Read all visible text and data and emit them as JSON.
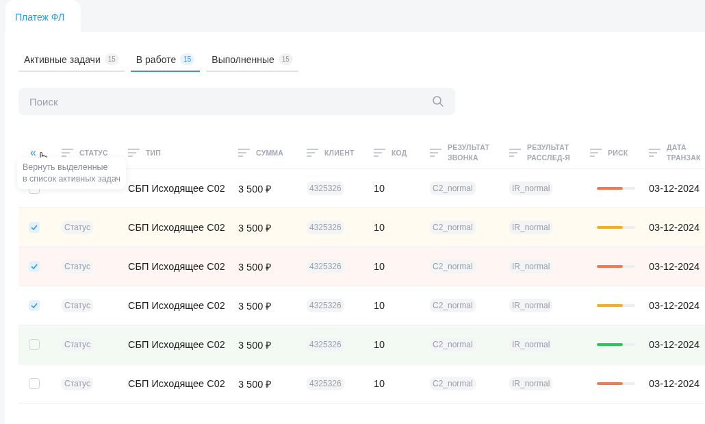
{
  "page_tab": {
    "label": "Платеж ФЛ",
    "selected": true
  },
  "tabs": [
    {
      "label": "Активные задачи",
      "count": "15",
      "selected": false
    },
    {
      "label": "В работе",
      "count": "15",
      "selected": true
    },
    {
      "label": "Выполненные",
      "count": "15",
      "selected": false
    }
  ],
  "search": {
    "placeholder": "Поиск"
  },
  "table": {
    "back_button": "«",
    "tooltip": "Вернуть выделенные\nв список активных задач",
    "columns": [
      {
        "label": "СТАТУС"
      },
      {
        "label": "ТИП"
      },
      {
        "label": "СУММА"
      },
      {
        "label": "КЛИЕНТ"
      },
      {
        "label": "КОД"
      },
      {
        "label": "РЕЗУЛЬТАТ\nЗВОНКА"
      },
      {
        "label": "РЕЗУЛЬТАТ\nРАССЛЕД-Я"
      },
      {
        "label": "РИСК"
      },
      {
        "label": "ДАТА\nТРАНЗАК"
      }
    ],
    "rows": [
      {
        "checked": false,
        "type": "СБП Исходящее С02",
        "amount": "3 500 ₽",
        "client": "4325326",
        "code": "10",
        "call_result": "C2_normal",
        "investigation": "IR_normal",
        "risk": {
          "level": 0.68,
          "color": "#f07a55"
        },
        "date": "03-12-2024"
      },
      {
        "checked": true,
        "color": "#fffbf1",
        "status": "Статус",
        "type": "СБП Исходящее С02",
        "amount": "3 500 ₽",
        "client": "4325326",
        "code": "10",
        "call_result": "C2_normal",
        "investigation": "IR_normal",
        "risk": {
          "level": 0.68,
          "color": "#f2b01e"
        },
        "date": "03-12-2024"
      },
      {
        "checked": true,
        "color": "#fff5f3",
        "status": "Статус",
        "type": "СБП Исходящее С02",
        "amount": "3 500 ₽",
        "client": "4325326",
        "code": "10",
        "call_result": "C2_normal",
        "investigation": "IR_normal",
        "risk": {
          "level": 0.68,
          "color": "#f07a55"
        },
        "date": "03-12-2024"
      },
      {
        "checked": true,
        "status": "Статус",
        "type": "СБП Исходящее С02",
        "amount": "3 500 ₽",
        "client": "4325326",
        "code": "10",
        "call_result": "C2_normal",
        "investigation": "IR_normal",
        "risk": {
          "level": 0.68,
          "color": "#f2b01e"
        },
        "date": "03-12-2024"
      },
      {
        "checked": false,
        "color": "#f3faf4",
        "status": "Статус",
        "type": "СБП Исходящее С02",
        "amount": "3 500 ₽",
        "client": "4325326",
        "code": "10",
        "call_result": "C2_normal",
        "investigation": "IR_normal",
        "risk": {
          "level": 0.68,
          "color": "#2cc55a"
        },
        "date": "03-12-2024"
      },
      {
        "checked": false,
        "status": "Статус",
        "type": "СБП Исходящее С02",
        "amount": "3 500 ₽",
        "client": "4325326",
        "code": "10",
        "call_result": "C2_normal",
        "investigation": "IR_normal",
        "risk": {
          "level": 0.68,
          "color": "#f07a55"
        },
        "date": "03-12-2024"
      }
    ]
  }
}
